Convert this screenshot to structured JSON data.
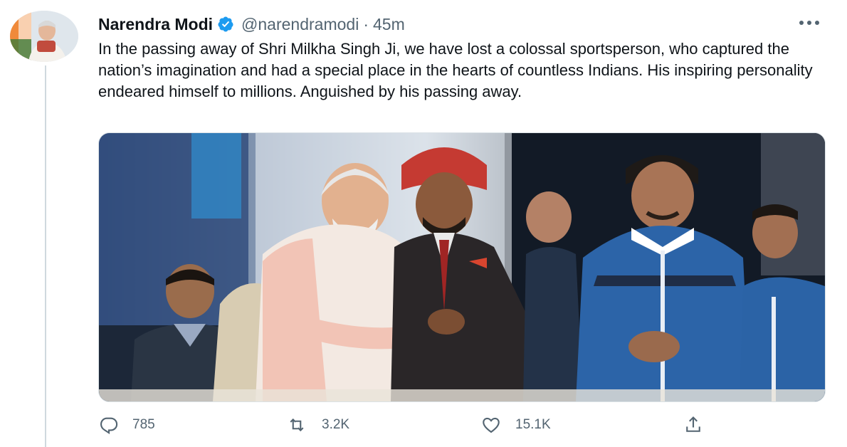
{
  "tweet": {
    "author_name": "Narendra Modi",
    "handle": "@narendramodi",
    "separator": "·",
    "time": "45m",
    "text": "In the passing away of Shri Milkha Singh Ji, we have lost a colossal sportsperson, who captured the nation’s imagination and had a special place in the hearts of countless Indians. His inspiring personality endeared himself to millions. Anguished by his passing away.",
    "more_icon": "more-horizontal-icon",
    "verified_icon": "verified-badge-icon"
  },
  "actions": {
    "reply": {
      "icon": "reply-icon",
      "count": "785"
    },
    "retweet": {
      "icon": "retweet-icon",
      "count": "3.2K"
    },
    "like": {
      "icon": "heart-icon",
      "count": "15.1K"
    },
    "share": {
      "icon": "share-icon"
    }
  },
  "colors": {
    "verified_blue": "#1d9bf0",
    "text_primary": "#0f1419",
    "text_secondary": "#536471"
  }
}
